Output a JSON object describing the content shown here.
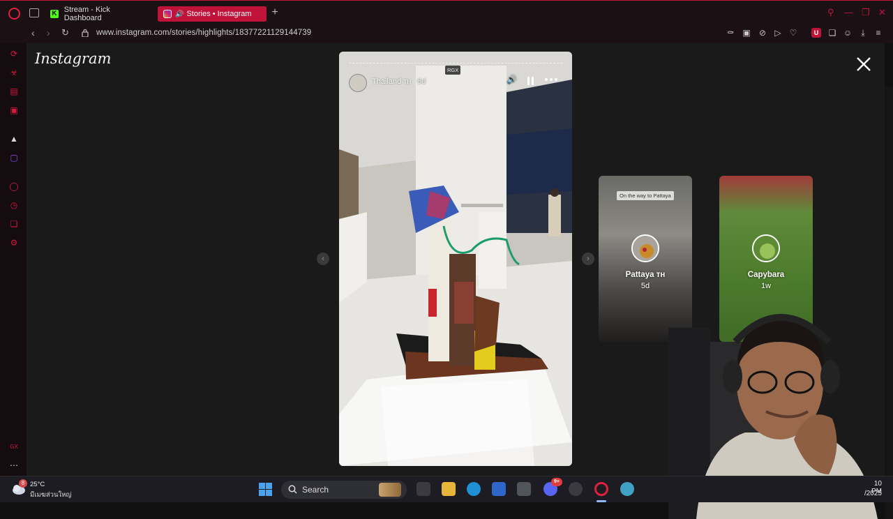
{
  "browser": {
    "tabs": [
      {
        "label": "Stream - Kick Dashboard",
        "active": false
      },
      {
        "label": "Stories • Instagram",
        "active": true
      }
    ],
    "url": "www.instagram.com/stories/highlights/18377221129144739",
    "accent_color": "#c0133a"
  },
  "page": {
    "logo_text": "Instagram",
    "story": {
      "badge": "RGX",
      "username": "Thailand ᴛʜ",
      "time": "6d"
    },
    "previews": [
      {
        "caption": "On the way to Pattaya",
        "name": "Pattaya ᴛʜ",
        "time": "5d"
      },
      {
        "caption": "",
        "name": "Capybara",
        "time": "1w"
      }
    ]
  },
  "taskbar": {
    "weather_badge": "8",
    "temperature": "25°C",
    "location": "มีเมฆส่วนใหญ่",
    "search_label": "Search",
    "discord_badge": "9+",
    "clock": "10 PM",
    "date": "/2025"
  }
}
